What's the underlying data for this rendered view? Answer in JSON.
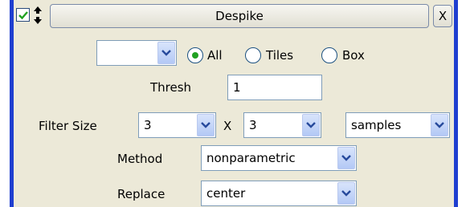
{
  "title": "Despike",
  "close_label": "X",
  "enabled": true,
  "region": {
    "dropdown_value": "",
    "options": [
      {
        "label": "All",
        "selected": true
      },
      {
        "label": "Tiles",
        "selected": false
      },
      {
        "label": "Box",
        "selected": false
      }
    ]
  },
  "thresh": {
    "label": "Thresh",
    "value": "1"
  },
  "filter_size": {
    "label": "Filter Size",
    "x_value": "3",
    "separator": "X",
    "y_value": "3",
    "unit": "samples"
  },
  "method": {
    "label": "Method",
    "value": "nonparametric"
  },
  "replace": {
    "label": "Replace",
    "value": "center"
  },
  "colors": {
    "accent": "#1f3fd0",
    "panel": "#ece9d8",
    "check": "#21a121"
  }
}
